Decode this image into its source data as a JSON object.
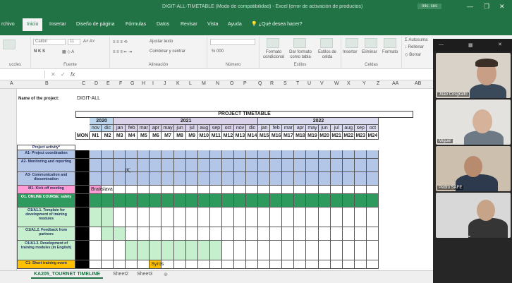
{
  "window": {
    "title": "DIGIT-ALL-TIMETABLE (Modo de compatibilidad) - Excel (error de activación de productos)",
    "signin": "Inic. ses",
    "controls": [
      "—",
      "❐",
      "✕"
    ]
  },
  "ribbon_tabs": [
    {
      "label": "rchivo",
      "active": false
    },
    {
      "label": "Inicio",
      "active": true
    },
    {
      "label": "Insertar",
      "active": false
    },
    {
      "label": "Diseño de página",
      "active": false
    },
    {
      "label": "Fórmulas",
      "active": false
    },
    {
      "label": "Datos",
      "active": false
    },
    {
      "label": "Revisar",
      "active": false
    },
    {
      "label": "Vista",
      "active": false
    },
    {
      "label": "Ayuda",
      "active": false
    }
  ],
  "tell_me": "¿Qué desea hacer?",
  "ribbon": {
    "font_name": "Calibri",
    "font_size": "11",
    "grow_font": "A˄ A˅",
    "bold_italic": "N K S",
    "wrap_text": "Ajustar texto",
    "merge_center": "Combinar y centrar",
    "number_format": "% 000",
    "conditional_format": "Formato condicional",
    "format_table": "Dar formato como tabla",
    "cell_styles": "Estilos de celda",
    "insert": "Insertar",
    "delete": "Eliminar",
    "format": "Formato",
    "autosum": "Autosuma",
    "fill": "Rellenar",
    "clear": "Borrar",
    "group_clipboard": "uccles",
    "group_font": "Fuente",
    "group_alignment": "Alineación",
    "group_number": "Número",
    "group_styles": "Estilos",
    "group_cells": "Celdas"
  },
  "formula_bar": {
    "fx": "fx"
  },
  "columns": [
    "A",
    "B",
    "C",
    "D",
    "E",
    "F",
    "G",
    "H",
    "I",
    "J",
    "K",
    "L",
    "M",
    "N",
    "O",
    "P",
    "Q",
    "R",
    "S",
    "T",
    "U",
    "V",
    "W",
    "X",
    "Y",
    "Z",
    "AA",
    "AB"
  ],
  "project": {
    "label": "Name of the project:",
    "value": "DIGIT-ALL"
  },
  "timetable": {
    "title": "PROJECT TIMETABLE",
    "years": [
      "2020",
      "2021",
      "2022"
    ],
    "months": [
      "nov",
      "dic",
      "jan",
      "feb",
      "mar",
      "apr",
      "may",
      "jun",
      "jul",
      "aug",
      "sep",
      "oct",
      "nov",
      "dic",
      "jan",
      "feb",
      "mar",
      "apr",
      "may",
      "jun",
      "jul",
      "aug",
      "sep",
      "oct"
    ],
    "mon_header": "MON",
    "month_codes": [
      "M1",
      "M2",
      "M3",
      "M4",
      "M5",
      "M6",
      "M7",
      "M8",
      "M9",
      "M10",
      "M11",
      "M12",
      "M13",
      "M14",
      "M15",
      "M16",
      "M17",
      "M18",
      "M19",
      "M20",
      "M21",
      "M22",
      "M23",
      "M24"
    ],
    "activity_header": "Project activity*",
    "activities": [
      {
        "label": "A1- Project coordination",
        "color": "#b4c6e7"
      },
      {
        "label": "A2- Monitoring and reporting",
        "color": "#b4c6e7"
      },
      {
        "label": "A3- Communication and dissemination",
        "color": "#b4c6e7"
      },
      {
        "label": "M1- Kick off meeting",
        "color": "#ff9bd5",
        "note": "Bratislava"
      },
      {
        "label": "O1. ONLINE COURSE: safety",
        "color": "#2e9a5e"
      },
      {
        "label": "O1/A1.1. Template for development of training modules",
        "color": "#c6efce"
      },
      {
        "label": "O1/A1.2. Feedback from partners",
        "color": "#c6efce"
      },
      {
        "label": "O1/A1.3. Development of training modules (in English)",
        "color": "#c6efce"
      },
      {
        "label": "C1- Short training event",
        "color": "#ffc000",
        "note": "Syros"
      }
    ]
  },
  "sheets": [
    {
      "label": "KA205_TOURNET TIMELINE",
      "active": true
    },
    {
      "label": "Sheet2",
      "active": false
    },
    {
      "label": "Sheet3",
      "active": false
    }
  ],
  "participants": [
    {
      "name": "João Cosgrado",
      "bg": "#d9d2c8"
    },
    {
      "name": "Miguel",
      "bg": "#e4e2df"
    },
    {
      "name": "Pedro SAFE",
      "bg": "#cdbfae"
    },
    {
      "name": "",
      "bg": "#d8d8d8"
    }
  ],
  "colors": {
    "excel_green": "#217346",
    "header_blue": "#dae3f3",
    "year_2020": "#bdd7ee",
    "year_2021": "#d9d2e9",
    "year_2022": "#dbdbf0"
  }
}
